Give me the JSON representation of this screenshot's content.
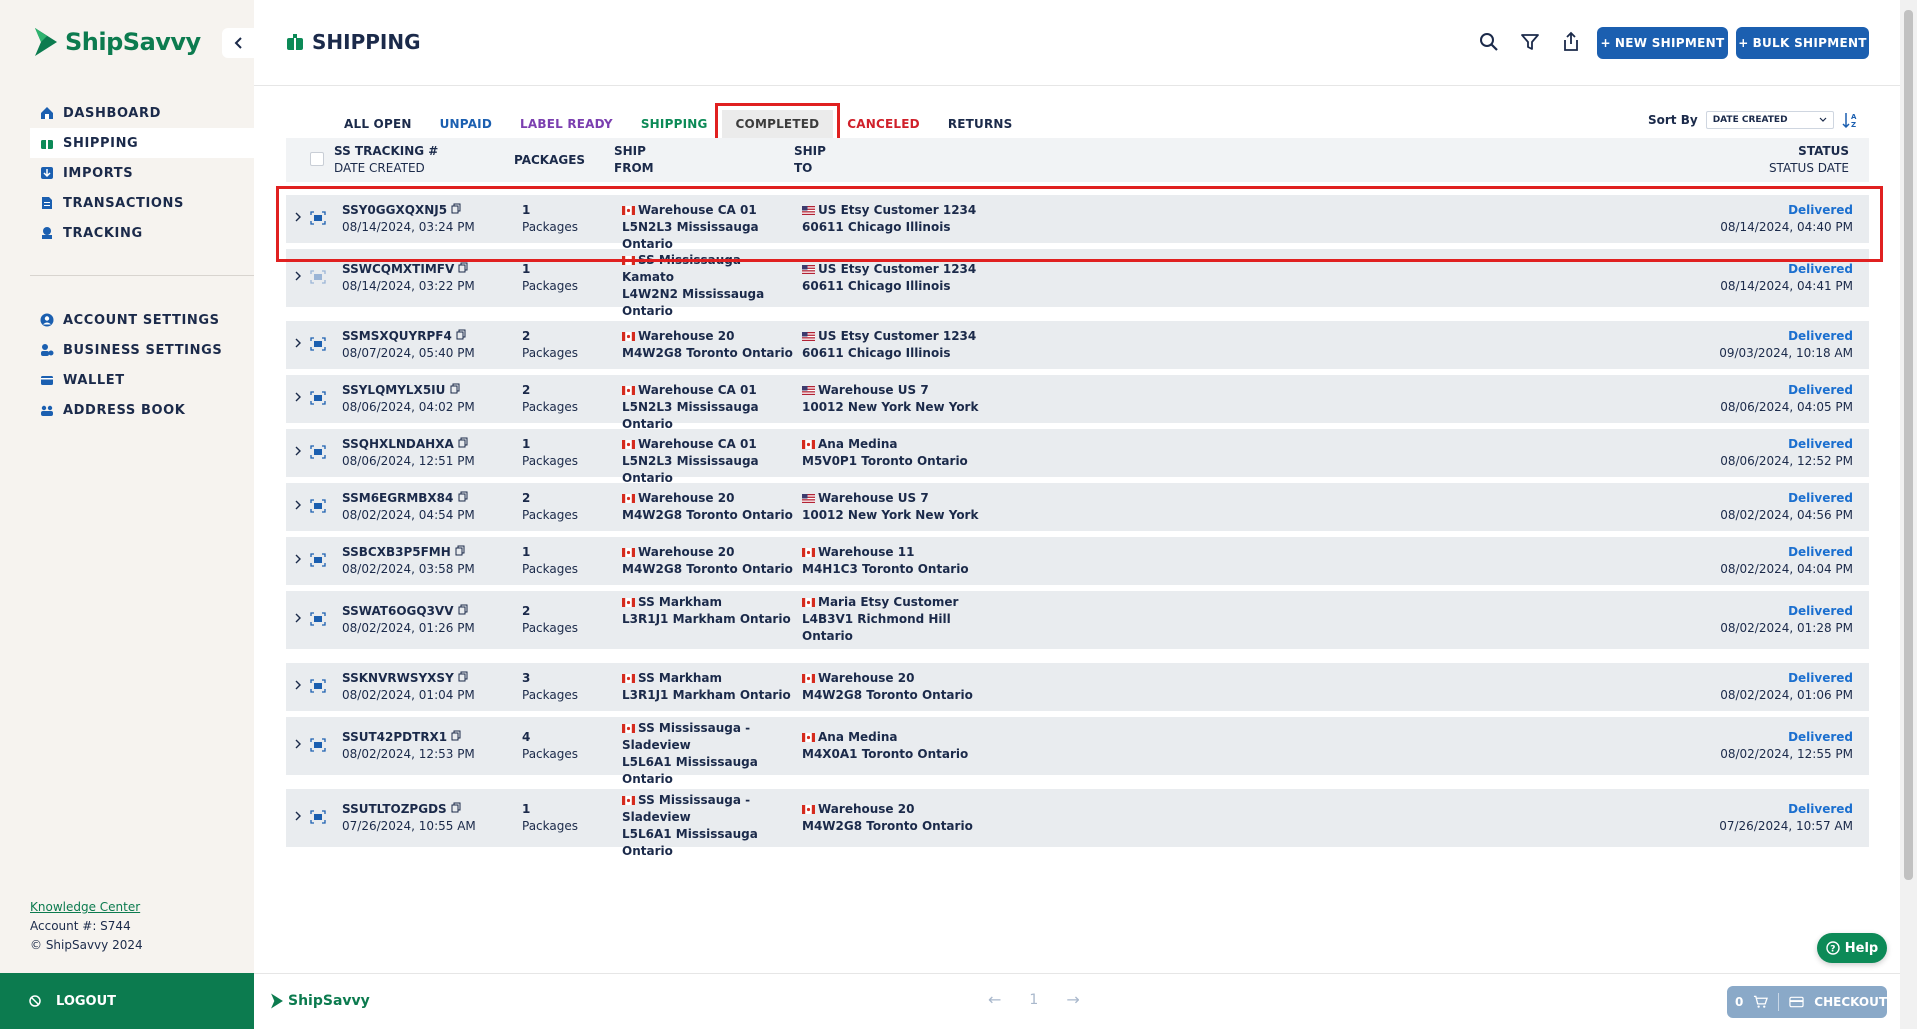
{
  "brand": {
    "name": "ShipSavvy",
    "color": "#0c7b4f",
    "accent": "#1b5fb0"
  },
  "sidebar": {
    "nav": [
      {
        "label": "DASHBOARD",
        "icon": "home-icon"
      },
      {
        "label": "SHIPPING",
        "icon": "package-icon",
        "active": true
      },
      {
        "label": "IMPORTS",
        "icon": "import-icon"
      },
      {
        "label": "TRANSACTIONS",
        "icon": "document-icon"
      },
      {
        "label": "TRACKING",
        "icon": "tracking-icon"
      }
    ],
    "nav2": [
      {
        "label": "ACCOUNT SETTINGS",
        "icon": "user-circle-icon"
      },
      {
        "label": "BUSINESS SETTINGS",
        "icon": "business-icon"
      },
      {
        "label": "WALLET",
        "icon": "wallet-icon"
      },
      {
        "label": "ADDRESS BOOK",
        "icon": "address-book-icon"
      }
    ],
    "knowledge_center": "Knowledge Center",
    "account": "Account #: S744",
    "copyright": "© ShipSavvy 2024",
    "logout": "LOGOUT"
  },
  "header": {
    "title": "SHIPPING",
    "new_shipment": "NEW SHIPMENT",
    "bulk_shipment": "BULK SHIPMENT"
  },
  "tabs": [
    {
      "label": "ALL OPEN",
      "color": "#1b2a4a"
    },
    {
      "label": "UNPAID",
      "color": "#1b5fb0"
    },
    {
      "label": "LABEL READY",
      "color": "#7b3fb0"
    },
    {
      "label": "SHIPPING",
      "color": "#0c8a57"
    },
    {
      "label": "COMPLETED",
      "color": "#3c3c3c",
      "selected": true
    },
    {
      "label": "CANCELED",
      "color": "#d0202a"
    },
    {
      "label": "RETURNS",
      "color": "#1b2a4a"
    }
  ],
  "sort": {
    "label": "Sort By",
    "value": "DATE CREATED"
  },
  "table": {
    "headers": {
      "tracking": "SS TRACKING #",
      "date_created": "DATE CREATED",
      "packages": "PACKAGES",
      "ship_from_1": "SHIP",
      "ship_from_2": "FROM",
      "ship_to_1": "SHIP",
      "ship_to_2": "TO",
      "status": "STATUS",
      "status_date": "STATUS DATE"
    },
    "rows": [
      {
        "tracking": "SSY0GGXQXNJ5",
        "created": "08/14/2024, 03:24 PM",
        "packages": "1",
        "pkg_label": "Packages",
        "from_flag": "ca",
        "from": [
          "Warehouse CA 01",
          "L5N2L3 Mississauga Ontario"
        ],
        "to_flag": "us",
        "to": [
          "US Etsy Customer 1234",
          "60611 Chicago Illinois"
        ],
        "status": "Delivered",
        "status_date": "08/14/2024, 04:40 PM"
      },
      {
        "tracking": "SSWCQMXTIMFV",
        "created": "08/14/2024, 03:22 PM",
        "packages": "1",
        "pkg_label": "Packages",
        "from_flag": "ca",
        "from": [
          "SS Mississauga - Kamato",
          "L4W2N2 Mississauga",
          "Ontario"
        ],
        "to_flag": "us",
        "to": [
          "US Etsy Customer 1234",
          "60611 Chicago Illinois"
        ],
        "status": "Delivered",
        "status_date": "08/14/2024, 04:41 PM"
      },
      {
        "tracking": "SSMSXQUYRPF4",
        "created": "08/07/2024, 05:40 PM",
        "packages": "2",
        "pkg_label": "Packages",
        "from_flag": "ca",
        "from": [
          "Warehouse 20",
          "M4W2G8 Toronto Ontario"
        ],
        "to_flag": "us",
        "to": [
          "US Etsy Customer 1234",
          "60611 Chicago Illinois"
        ],
        "status": "Delivered",
        "status_date": "09/03/2024, 10:18 AM"
      },
      {
        "tracking": "SSYLQMYLX5IU",
        "created": "08/06/2024, 04:02 PM",
        "packages": "2",
        "pkg_label": "Packages",
        "from_flag": "ca",
        "from": [
          "Warehouse CA 01",
          "L5N2L3 Mississauga Ontario"
        ],
        "to_flag": "us",
        "to": [
          "Warehouse US 7",
          "10012 New York New York"
        ],
        "status": "Delivered",
        "status_date": "08/06/2024, 04:05 PM"
      },
      {
        "tracking": "SSQHXLNDAHXA",
        "created": "08/06/2024, 12:51 PM",
        "packages": "1",
        "pkg_label": "Packages",
        "from_flag": "ca",
        "from": [
          "Warehouse CA 01",
          "L5N2L3 Mississauga Ontario"
        ],
        "to_flag": "ca",
        "to": [
          "Ana Medina",
          "M5V0P1 Toronto Ontario"
        ],
        "status": "Delivered",
        "status_date": "08/06/2024, 12:52 PM"
      },
      {
        "tracking": "SSM6EGRMBX84",
        "created": "08/02/2024, 04:54 PM",
        "packages": "2",
        "pkg_label": "Packages",
        "from_flag": "ca",
        "from": [
          "Warehouse 20",
          "M4W2G8 Toronto Ontario"
        ],
        "to_flag": "us",
        "to": [
          "Warehouse US 7",
          "10012 New York New York"
        ],
        "status": "Delivered",
        "status_date": "08/02/2024, 04:56 PM"
      },
      {
        "tracking": "SSBCXB3P5FMH",
        "created": "08/02/2024, 03:58 PM",
        "packages": "1",
        "pkg_label": "Packages",
        "from_flag": "ca",
        "from": [
          "Warehouse 20",
          "M4W2G8 Toronto Ontario"
        ],
        "to_flag": "ca",
        "to": [
          "Warehouse 11",
          "M4H1C3 Toronto Ontario"
        ],
        "status": "Delivered",
        "status_date": "08/02/2024, 04:04 PM"
      },
      {
        "tracking": "SSWAT6OGQ3VV",
        "created": "08/02/2024, 01:26 PM",
        "packages": "2",
        "pkg_label": "Packages",
        "from_flag": "ca",
        "from": [
          "SS Markham",
          "L3R1J1 Markham Ontario"
        ],
        "to_flag": "ca",
        "to": [
          "Maria Etsy Customer",
          "L4B3V1 Richmond Hill",
          "Ontario"
        ],
        "status": "Delivered",
        "status_date": "08/02/2024, 01:28 PM"
      },
      {
        "tracking": "SSKNVRWSYXSY",
        "created": "08/02/2024, 01:04 PM",
        "packages": "3",
        "pkg_label": "Packages",
        "from_flag": "ca",
        "from": [
          "SS Markham",
          "L3R1J1 Markham Ontario"
        ],
        "to_flag": "ca",
        "to": [
          "Warehouse 20",
          "M4W2G8 Toronto Ontario"
        ],
        "status": "Delivered",
        "status_date": "08/02/2024, 01:06 PM"
      },
      {
        "tracking": "SSUT42PDTRX1",
        "created": "08/02/2024, 12:53 PM",
        "packages": "4",
        "pkg_label": "Packages",
        "from_flag": "ca",
        "from": [
          "SS Mississauga -",
          "Sladeview",
          "L5L6A1 Mississauga Ontario"
        ],
        "to_flag": "ca",
        "to": [
          "Ana Medina",
          "M4X0A1 Toronto Ontario"
        ],
        "status": "Delivered",
        "status_date": "08/02/2024, 12:55 PM"
      },
      {
        "tracking": "SSUTLTOZPGDS",
        "created": "07/26/2024, 10:55 AM",
        "packages": "1",
        "pkg_label": "Packages",
        "from_flag": "ca",
        "from": [
          "SS Mississauga -",
          "Sladeview",
          "L5L6A1 Mississauga Ontario"
        ],
        "to_flag": "ca",
        "to": [
          "Warehouse 20",
          "M4W2G8 Toronto Ontario"
        ],
        "status": "Delivered",
        "status_date": "07/26/2024, 10:57 AM"
      }
    ]
  },
  "footer": {
    "page": "1",
    "cart_count": "0",
    "checkout": "CHECKOUT"
  },
  "help": "Help"
}
